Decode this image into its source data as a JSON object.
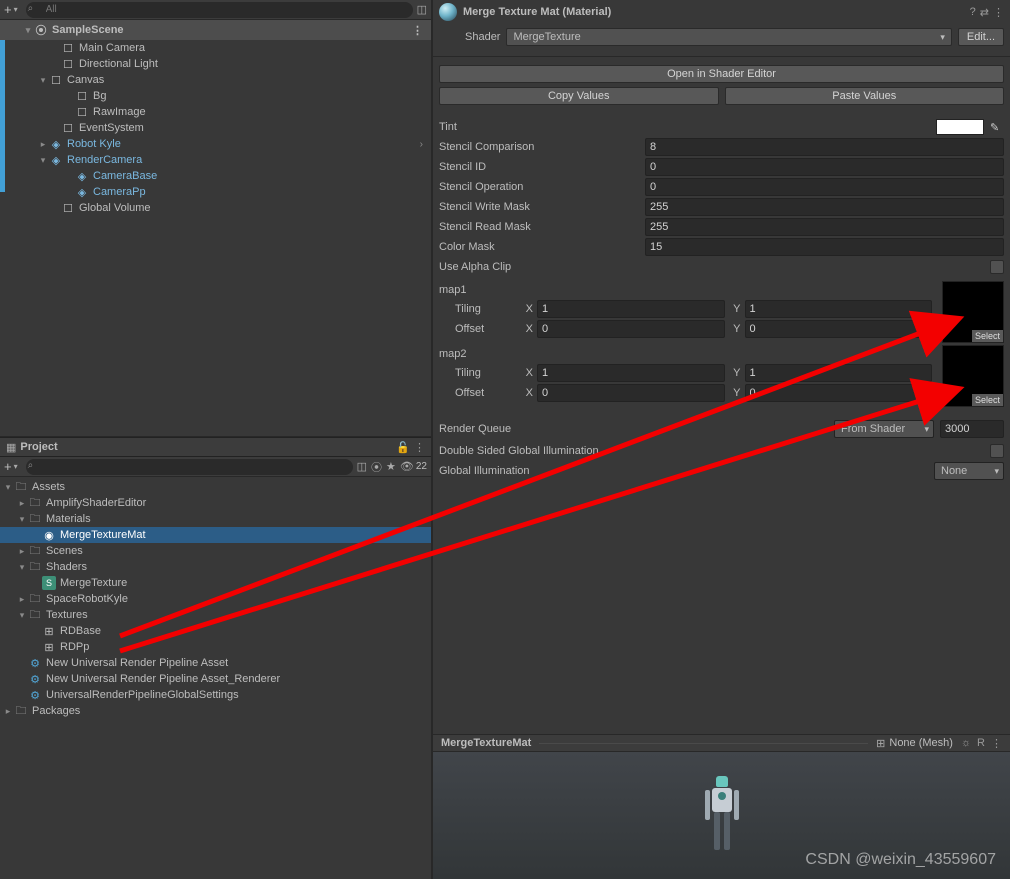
{
  "hierarchy": {
    "search_placeholder": "All",
    "scene_name": "SampleScene",
    "items": [
      "Main Camera",
      "Directional Light",
      "Canvas",
      "Bg",
      "RawImage",
      "EventSystem",
      "Robot Kyle",
      "RenderCamera",
      "CameraBase",
      "CameraPp",
      "Global Volume"
    ]
  },
  "project": {
    "title": "Project",
    "count": "22",
    "root": "Assets",
    "items": {
      "amplify": "AmplifyShaderEditor",
      "materials": "Materials",
      "mergemat": "MergeTextureMat",
      "scenes": "Scenes",
      "shaders": "Shaders",
      "mergetexture": "MergeTexture",
      "spacerobot": "SpaceRobotKyle",
      "textures": "Textures",
      "rdbase": "RDBase",
      "rdpp": "RDPp",
      "pipeA": "New Universal Render Pipeline Asset",
      "pipeR": "New Universal Render Pipeline Asset_Renderer",
      "pipeG": "UniversalRenderPipelineGlobalSettings",
      "packages": "Packages"
    }
  },
  "inspector": {
    "material_name": "Merge Texture Mat (Material)",
    "shader_label": "Shader",
    "shader_value": "MergeTexture",
    "edit": "Edit...",
    "open_editor": "Open in Shader Editor",
    "copy": "Copy Values",
    "paste": "Paste Values",
    "props": {
      "tint": "Tint",
      "stencil_cmp": {
        "label": "Stencil Comparison",
        "value": "8"
      },
      "stencil_id": {
        "label": "Stencil ID",
        "value": "0"
      },
      "stencil_op": {
        "label": "Stencil Operation",
        "value": "0"
      },
      "stencil_wm": {
        "label": "Stencil Write Mask",
        "value": "255"
      },
      "stencil_rm": {
        "label": "Stencil Read Mask",
        "value": "255"
      },
      "color_mask": {
        "label": "Color Mask",
        "value": "15"
      },
      "alpha_clip": "Use Alpha Clip"
    },
    "map1": {
      "label": "map1",
      "tiling": "Tiling",
      "offset": "Offset",
      "x_label": "X",
      "y_label": "Y",
      "tiling_x": "1",
      "tiling_y": "1",
      "offset_x": "0",
      "offset_y": "0",
      "select": "Select"
    },
    "map2": {
      "label": "map2",
      "tiling": "Tiling",
      "offset": "Offset",
      "tiling_x": "1",
      "tiling_y": "1",
      "offset_x": "0",
      "offset_y": "0",
      "select": "Select"
    },
    "render_queue": {
      "label": "Render Queue",
      "mode": "From Shader",
      "value": "3000"
    },
    "dsgi": "Double Sided Global Illumination",
    "gi": {
      "label": "Global Illumination",
      "value": "None"
    }
  },
  "preview": {
    "name": "MergeTextureMat",
    "mesh": "None (Mesh)",
    "grid_icon": "⊞",
    "light_icon": "☼",
    "r_icon": "R"
  },
  "watermark": "CSDN @weixin_43559607"
}
